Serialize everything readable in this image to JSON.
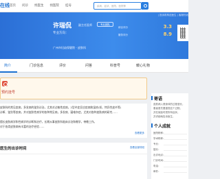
{
  "nav": {
    "logo": "在线",
    "links": [
      "首页",
      "问诊",
      "找医生",
      "找医院",
      "挂号"
    ],
    "search_placeholder": "疾病、症状、医院、医院等"
  },
  "banner": {
    "top_links": "| 投诉机构送医生 | 客服热线",
    "doctor_name": "许瑞侃",
    "doctor_title": "副主任医师",
    "tag": "专业团队",
    "dept_label": "专业方向：",
    "hospital": "广州市妇幼保健院 - 皮肤科",
    "scores": [
      {
        "label": "综合评分",
        "value": "3.3"
      },
      {
        "label": "服务评分",
        "value": "8.9"
      }
    ]
  },
  "tabs": [
    "简介",
    "门诊信息",
    "评价",
    "问答",
    "科普号",
    "暖心礼物"
  ],
  "alert": {
    "text": "预约挂号"
  },
  "intro": {
    "lines": [
      "皮肤科的常见疾病，多发病的鉴别诊治，尤其对过敏性疾病，2型炎症反应疾病和湿疹(如，特异性皮炎等)",
      "诊断、鉴别等疾病，并对皮肤性病学的各种常见病，多发病、疑难杂症，尤其对各种皮肤病的研究……",
      "",
      "擅长皮肤病学和性病学的诊断和治疗，长期从事皮肤科临床诊治和教学，带教工作。",
      "对于各类皮肤病有丰富的治疗经验……"
    ],
    "more": "查看更多"
  },
  "schedule": {
    "title": "医生的出诊时间",
    "more": "查看全部排班"
  },
  "side1": {
    "title": "寄语",
    "lines": [
      "皮肤病入侵身体的过程漫长，",
      "患者首先要重视这个过程，",
      "并在就医时把所有症状，",
      "并详细地告诉医生，",
      "以免漏诊误诊。"
    ]
  },
  "side2": {
    "title": "个人成就",
    "labels": [
      "医院职称：",
      "学术职称：",
      "专长：",
      "擅长：",
      "出诊地点：",
      "门诊时间：",
      "电话：",
      "邮件："
    ]
  }
}
